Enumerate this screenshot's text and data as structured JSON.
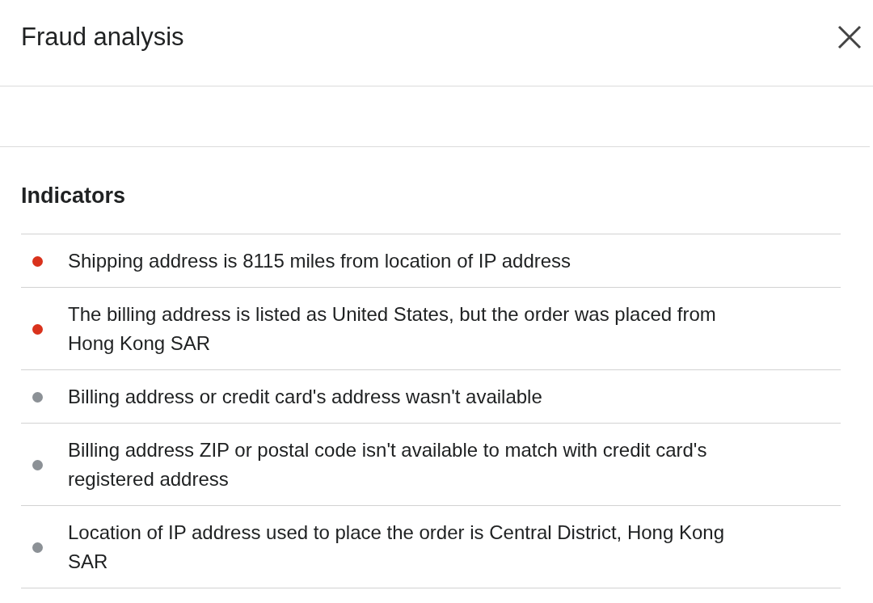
{
  "header": {
    "title": "Fraud analysis"
  },
  "indicators": {
    "heading": "Indicators",
    "items": [
      {
        "text": "Shipping address is 8115 miles from location of IP address",
        "color": "#d9321c"
      },
      {
        "text": "The billing address is listed as United States, but the order was placed from Hong Kong SAR",
        "color": "#d9321c"
      },
      {
        "text": "Billing address or credit card's address wasn't available",
        "color": "#8c9196"
      },
      {
        "text": "Billing address ZIP or postal code isn't available to match with credit card's registered address",
        "color": "#8c9196"
      },
      {
        "text": "Location of IP address used to place the order is Central District, Hong Kong SAR",
        "color": "#8c9196"
      }
    ]
  }
}
